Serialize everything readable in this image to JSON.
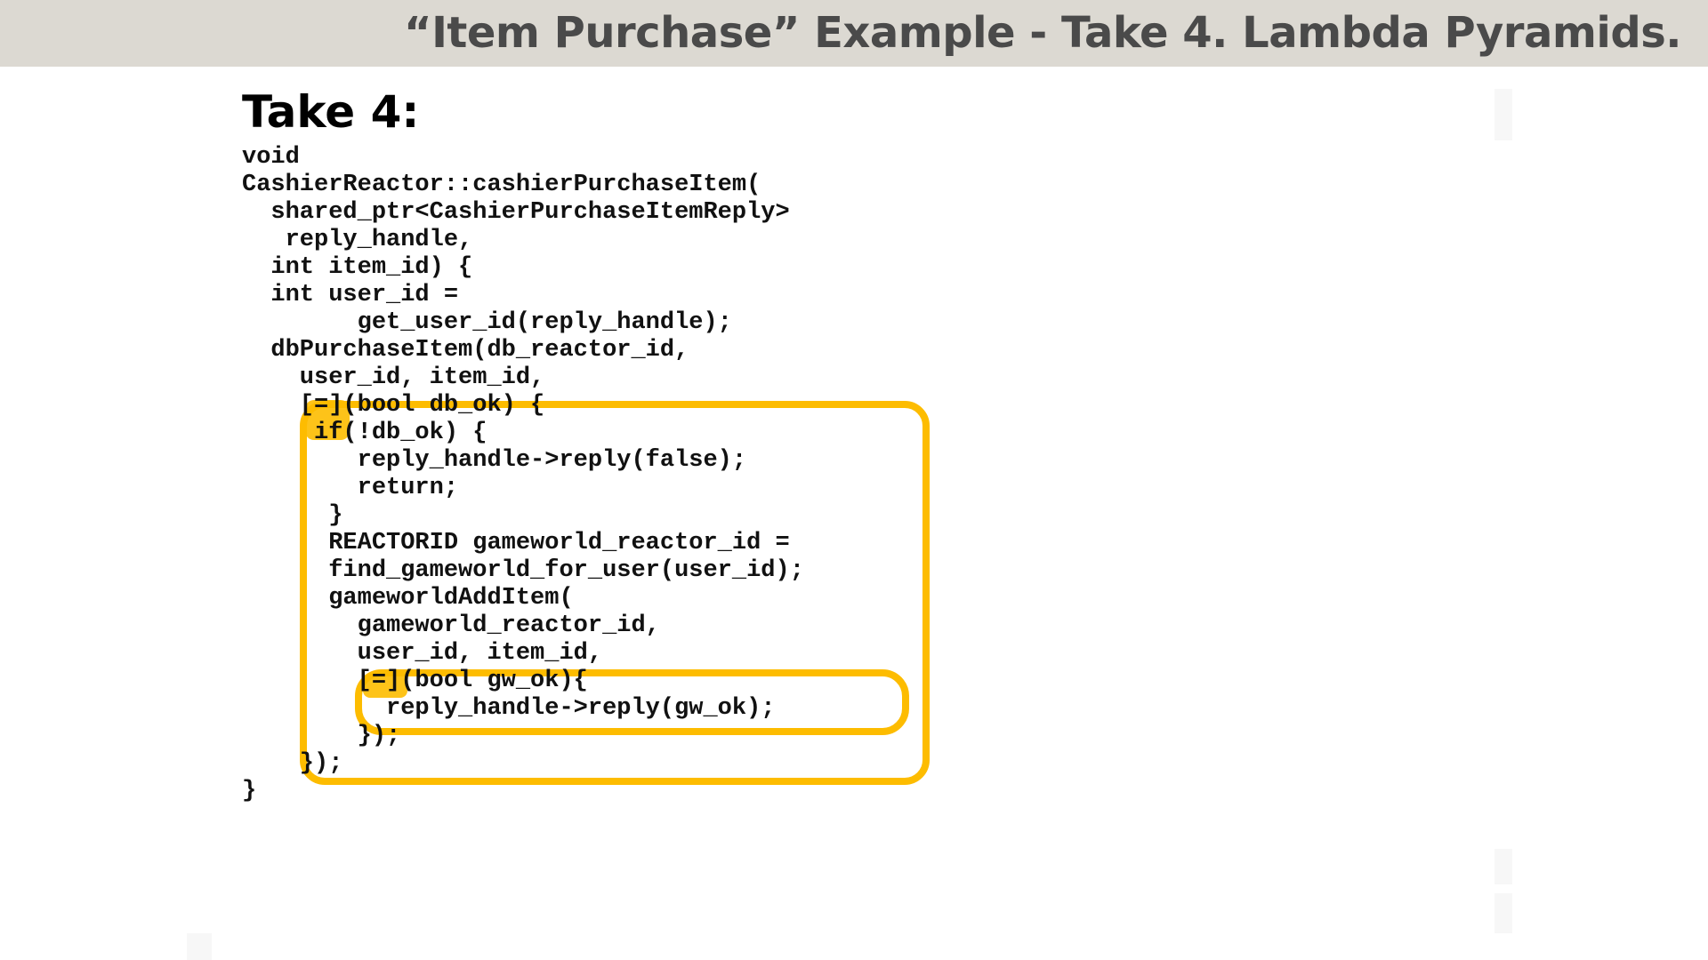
{
  "slide": {
    "title": "“Item Purchase” Example - Take 4. Lambda Pyramids.",
    "heading": "Take 4:"
  },
  "code": {
    "lines": [
      "void",
      "CashierReactor::cashierPurchaseItem(",
      "  shared_ptr<CashierPurchaseItemReply>",
      "   reply_handle,",
      "  int item_id) {",
      "  int user_id =",
      "        get_user_id(reply_handle);",
      "  dbPurchaseItem(db_reactor_id,",
      "    user_id, item_id,",
      "    [=](bool db_ok) {",
      "     if(!db_ok) {",
      "        reply_handle->reply(false);",
      "        return;",
      "      }",
      "      REACTORID gameworld_reactor_id =",
      "      find_gameworld_for_user(user_id);",
      "      gameworldAddItem(",
      "        gameworld_reactor_id,",
      "        user_id, item_id,",
      "        [=](bool gw_ok){",
      "          reply_handle->reply(gw_ok);",
      "        });",
      "    });",
      "}"
    ]
  },
  "highlight": {
    "color": "#fdbc00"
  }
}
